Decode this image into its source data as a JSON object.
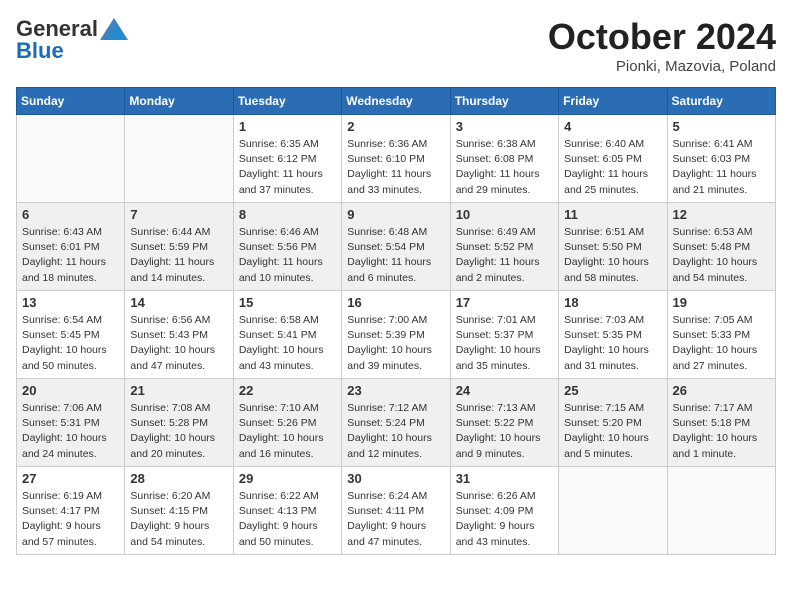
{
  "header": {
    "logo_general": "General",
    "logo_blue": "Blue",
    "month": "October 2024",
    "location": "Pionki, Mazovia, Poland"
  },
  "days_of_week": [
    "Sunday",
    "Monday",
    "Tuesday",
    "Wednesday",
    "Thursday",
    "Friday",
    "Saturday"
  ],
  "weeks": [
    [
      {
        "day": "",
        "info": ""
      },
      {
        "day": "",
        "info": ""
      },
      {
        "day": "1",
        "info": "Sunrise: 6:35 AM\nSunset: 6:12 PM\nDaylight: 11 hours and 37 minutes."
      },
      {
        "day": "2",
        "info": "Sunrise: 6:36 AM\nSunset: 6:10 PM\nDaylight: 11 hours and 33 minutes."
      },
      {
        "day": "3",
        "info": "Sunrise: 6:38 AM\nSunset: 6:08 PM\nDaylight: 11 hours and 29 minutes."
      },
      {
        "day": "4",
        "info": "Sunrise: 6:40 AM\nSunset: 6:05 PM\nDaylight: 11 hours and 25 minutes."
      },
      {
        "day": "5",
        "info": "Sunrise: 6:41 AM\nSunset: 6:03 PM\nDaylight: 11 hours and 21 minutes."
      }
    ],
    [
      {
        "day": "6",
        "info": "Sunrise: 6:43 AM\nSunset: 6:01 PM\nDaylight: 11 hours and 18 minutes."
      },
      {
        "day": "7",
        "info": "Sunrise: 6:44 AM\nSunset: 5:59 PM\nDaylight: 11 hours and 14 minutes."
      },
      {
        "day": "8",
        "info": "Sunrise: 6:46 AM\nSunset: 5:56 PM\nDaylight: 11 hours and 10 minutes."
      },
      {
        "day": "9",
        "info": "Sunrise: 6:48 AM\nSunset: 5:54 PM\nDaylight: 11 hours and 6 minutes."
      },
      {
        "day": "10",
        "info": "Sunrise: 6:49 AM\nSunset: 5:52 PM\nDaylight: 11 hours and 2 minutes."
      },
      {
        "day": "11",
        "info": "Sunrise: 6:51 AM\nSunset: 5:50 PM\nDaylight: 10 hours and 58 minutes."
      },
      {
        "day": "12",
        "info": "Sunrise: 6:53 AM\nSunset: 5:48 PM\nDaylight: 10 hours and 54 minutes."
      }
    ],
    [
      {
        "day": "13",
        "info": "Sunrise: 6:54 AM\nSunset: 5:45 PM\nDaylight: 10 hours and 50 minutes."
      },
      {
        "day": "14",
        "info": "Sunrise: 6:56 AM\nSunset: 5:43 PM\nDaylight: 10 hours and 47 minutes."
      },
      {
        "day": "15",
        "info": "Sunrise: 6:58 AM\nSunset: 5:41 PM\nDaylight: 10 hours and 43 minutes."
      },
      {
        "day": "16",
        "info": "Sunrise: 7:00 AM\nSunset: 5:39 PM\nDaylight: 10 hours and 39 minutes."
      },
      {
        "day": "17",
        "info": "Sunrise: 7:01 AM\nSunset: 5:37 PM\nDaylight: 10 hours and 35 minutes."
      },
      {
        "day": "18",
        "info": "Sunrise: 7:03 AM\nSunset: 5:35 PM\nDaylight: 10 hours and 31 minutes."
      },
      {
        "day": "19",
        "info": "Sunrise: 7:05 AM\nSunset: 5:33 PM\nDaylight: 10 hours and 27 minutes."
      }
    ],
    [
      {
        "day": "20",
        "info": "Sunrise: 7:06 AM\nSunset: 5:31 PM\nDaylight: 10 hours and 24 minutes."
      },
      {
        "day": "21",
        "info": "Sunrise: 7:08 AM\nSunset: 5:28 PM\nDaylight: 10 hours and 20 minutes."
      },
      {
        "day": "22",
        "info": "Sunrise: 7:10 AM\nSunset: 5:26 PM\nDaylight: 10 hours and 16 minutes."
      },
      {
        "day": "23",
        "info": "Sunrise: 7:12 AM\nSunset: 5:24 PM\nDaylight: 10 hours and 12 minutes."
      },
      {
        "day": "24",
        "info": "Sunrise: 7:13 AM\nSunset: 5:22 PM\nDaylight: 10 hours and 9 minutes."
      },
      {
        "day": "25",
        "info": "Sunrise: 7:15 AM\nSunset: 5:20 PM\nDaylight: 10 hours and 5 minutes."
      },
      {
        "day": "26",
        "info": "Sunrise: 7:17 AM\nSunset: 5:18 PM\nDaylight: 10 hours and 1 minute."
      }
    ],
    [
      {
        "day": "27",
        "info": "Sunrise: 6:19 AM\nSunset: 4:17 PM\nDaylight: 9 hours and 57 minutes."
      },
      {
        "day": "28",
        "info": "Sunrise: 6:20 AM\nSunset: 4:15 PM\nDaylight: 9 hours and 54 minutes."
      },
      {
        "day": "29",
        "info": "Sunrise: 6:22 AM\nSunset: 4:13 PM\nDaylight: 9 hours and 50 minutes."
      },
      {
        "day": "30",
        "info": "Sunrise: 6:24 AM\nSunset: 4:11 PM\nDaylight: 9 hours and 47 minutes."
      },
      {
        "day": "31",
        "info": "Sunrise: 6:26 AM\nSunset: 4:09 PM\nDaylight: 9 hours and 43 minutes."
      },
      {
        "day": "",
        "info": ""
      },
      {
        "day": "",
        "info": ""
      }
    ]
  ]
}
